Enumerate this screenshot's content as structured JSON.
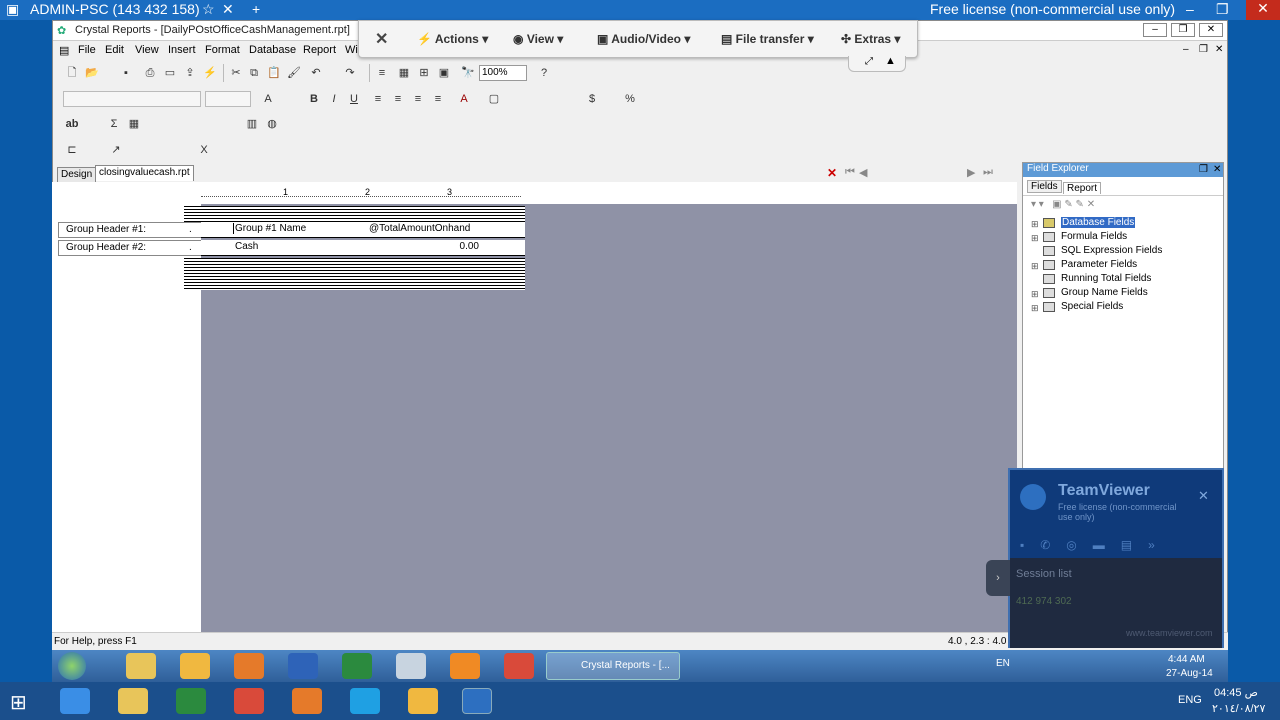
{
  "tv_title": "ADMIN-PSC (143 432 158)",
  "tv_license": "Free license (non-commercial use only)",
  "app_title": "Crystal Reports - [DailyPOstOfficeCashManagement.rpt]",
  "menu": [
    "File",
    "Edit",
    "View",
    "Insert",
    "Format",
    "Database",
    "Report",
    "Wi"
  ],
  "tv_toolbar": [
    "Actions",
    "View",
    "Audio/Video",
    "File transfer",
    "Extras"
  ],
  "zoom": "100%",
  "tabs": [
    "Design",
    "closingvaluecash.rpt"
  ],
  "rows": [
    {
      "label": "Group Header #1:",
      "dot": ".",
      "field1": "Group #1 Name",
      "field2": "@TotalAmountOnhand"
    },
    {
      "label": "Group Header #2:",
      "dot": ".",
      "field1": "Cash",
      "field2": "0.00"
    }
  ],
  "ruler_marks": [
    "1",
    "2",
    "3"
  ],
  "field_explorer": {
    "title": "Field Explorer",
    "tabs": [
      "Fields",
      "Report"
    ],
    "items": [
      "Database Fields",
      "Formula Fields",
      "SQL Expression Fields",
      "Parameter Fields",
      "Running Total Fields",
      "Group Name Fields",
      "Special Fields"
    ]
  },
  "status_left": "For Help, press F1",
  "status_right": "4.0 , 2.3 : 4.0",
  "taskbar_app": "Crystal Reports - [...",
  "tray": {
    "lang": "EN",
    "time": "4:44 AM",
    "date": "27-Aug-14"
  },
  "tray2": {
    "lang": "ENG",
    "time": "04:45 ص",
    "date": "٢٠١٤/٠٨/٢٧"
  },
  "teamviewer": {
    "name": "TeamViewer",
    "sub": "Free license (non-commercial use only)",
    "session": "Session list",
    "id": "412 974 302",
    "web": "www.teamviewer.com"
  }
}
